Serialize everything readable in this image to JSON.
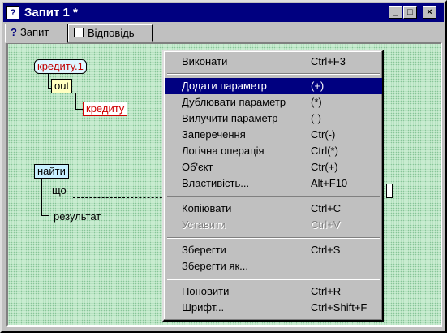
{
  "window": {
    "title": "Запит 1 *",
    "minimize": "_",
    "maximize": "□",
    "close": "×",
    "icon": "app-icon"
  },
  "tabs": [
    {
      "label": "Запит",
      "icon": "question-icon",
      "glyph": "?",
      "active": true
    },
    {
      "label": "Відповідь",
      "icon": "form-icon",
      "active": false
    }
  ],
  "diagram": {
    "node_kredytu1": "кредиту.1",
    "node_out": "out",
    "node_kredytu": "кредиту",
    "node_znaity": "найти",
    "label_shcho": "що",
    "label_rezultat": "результат"
  },
  "menu": {
    "items": [
      {
        "label": "Виконати",
        "shortcut": "Ctrl+F3"
      },
      {
        "label": "Додати параметр",
        "shortcut": "(+)",
        "selected": true
      },
      {
        "label": "Дублювати параметр",
        "shortcut": "(*)"
      },
      {
        "label": "Вилучити параметр",
        "shortcut": "(-)"
      },
      {
        "label": "Заперечення",
        "shortcut": "Ctr(-)"
      },
      {
        "label": "Логічна операція",
        "shortcut": "Ctrl(*)"
      },
      {
        "label": "Об'єкт",
        "shortcut": "Ctr(+)"
      },
      {
        "label": "Властивість...",
        "shortcut": "Alt+F10"
      },
      {
        "label": "Копіювати",
        "shortcut": "Ctrl+C"
      },
      {
        "label": "Уставити",
        "shortcut": "Ctrl+V",
        "disabled": true
      },
      {
        "label": "Зберегти",
        "shortcut": "Ctrl+S"
      },
      {
        "label": "Зберегти як...",
        "shortcut": ""
      },
      {
        "label": "Поновити",
        "shortcut": "Ctrl+R"
      },
      {
        "label": "Шрифт...",
        "shortcut": "Ctrl+Shift+F"
      }
    ]
  }
}
